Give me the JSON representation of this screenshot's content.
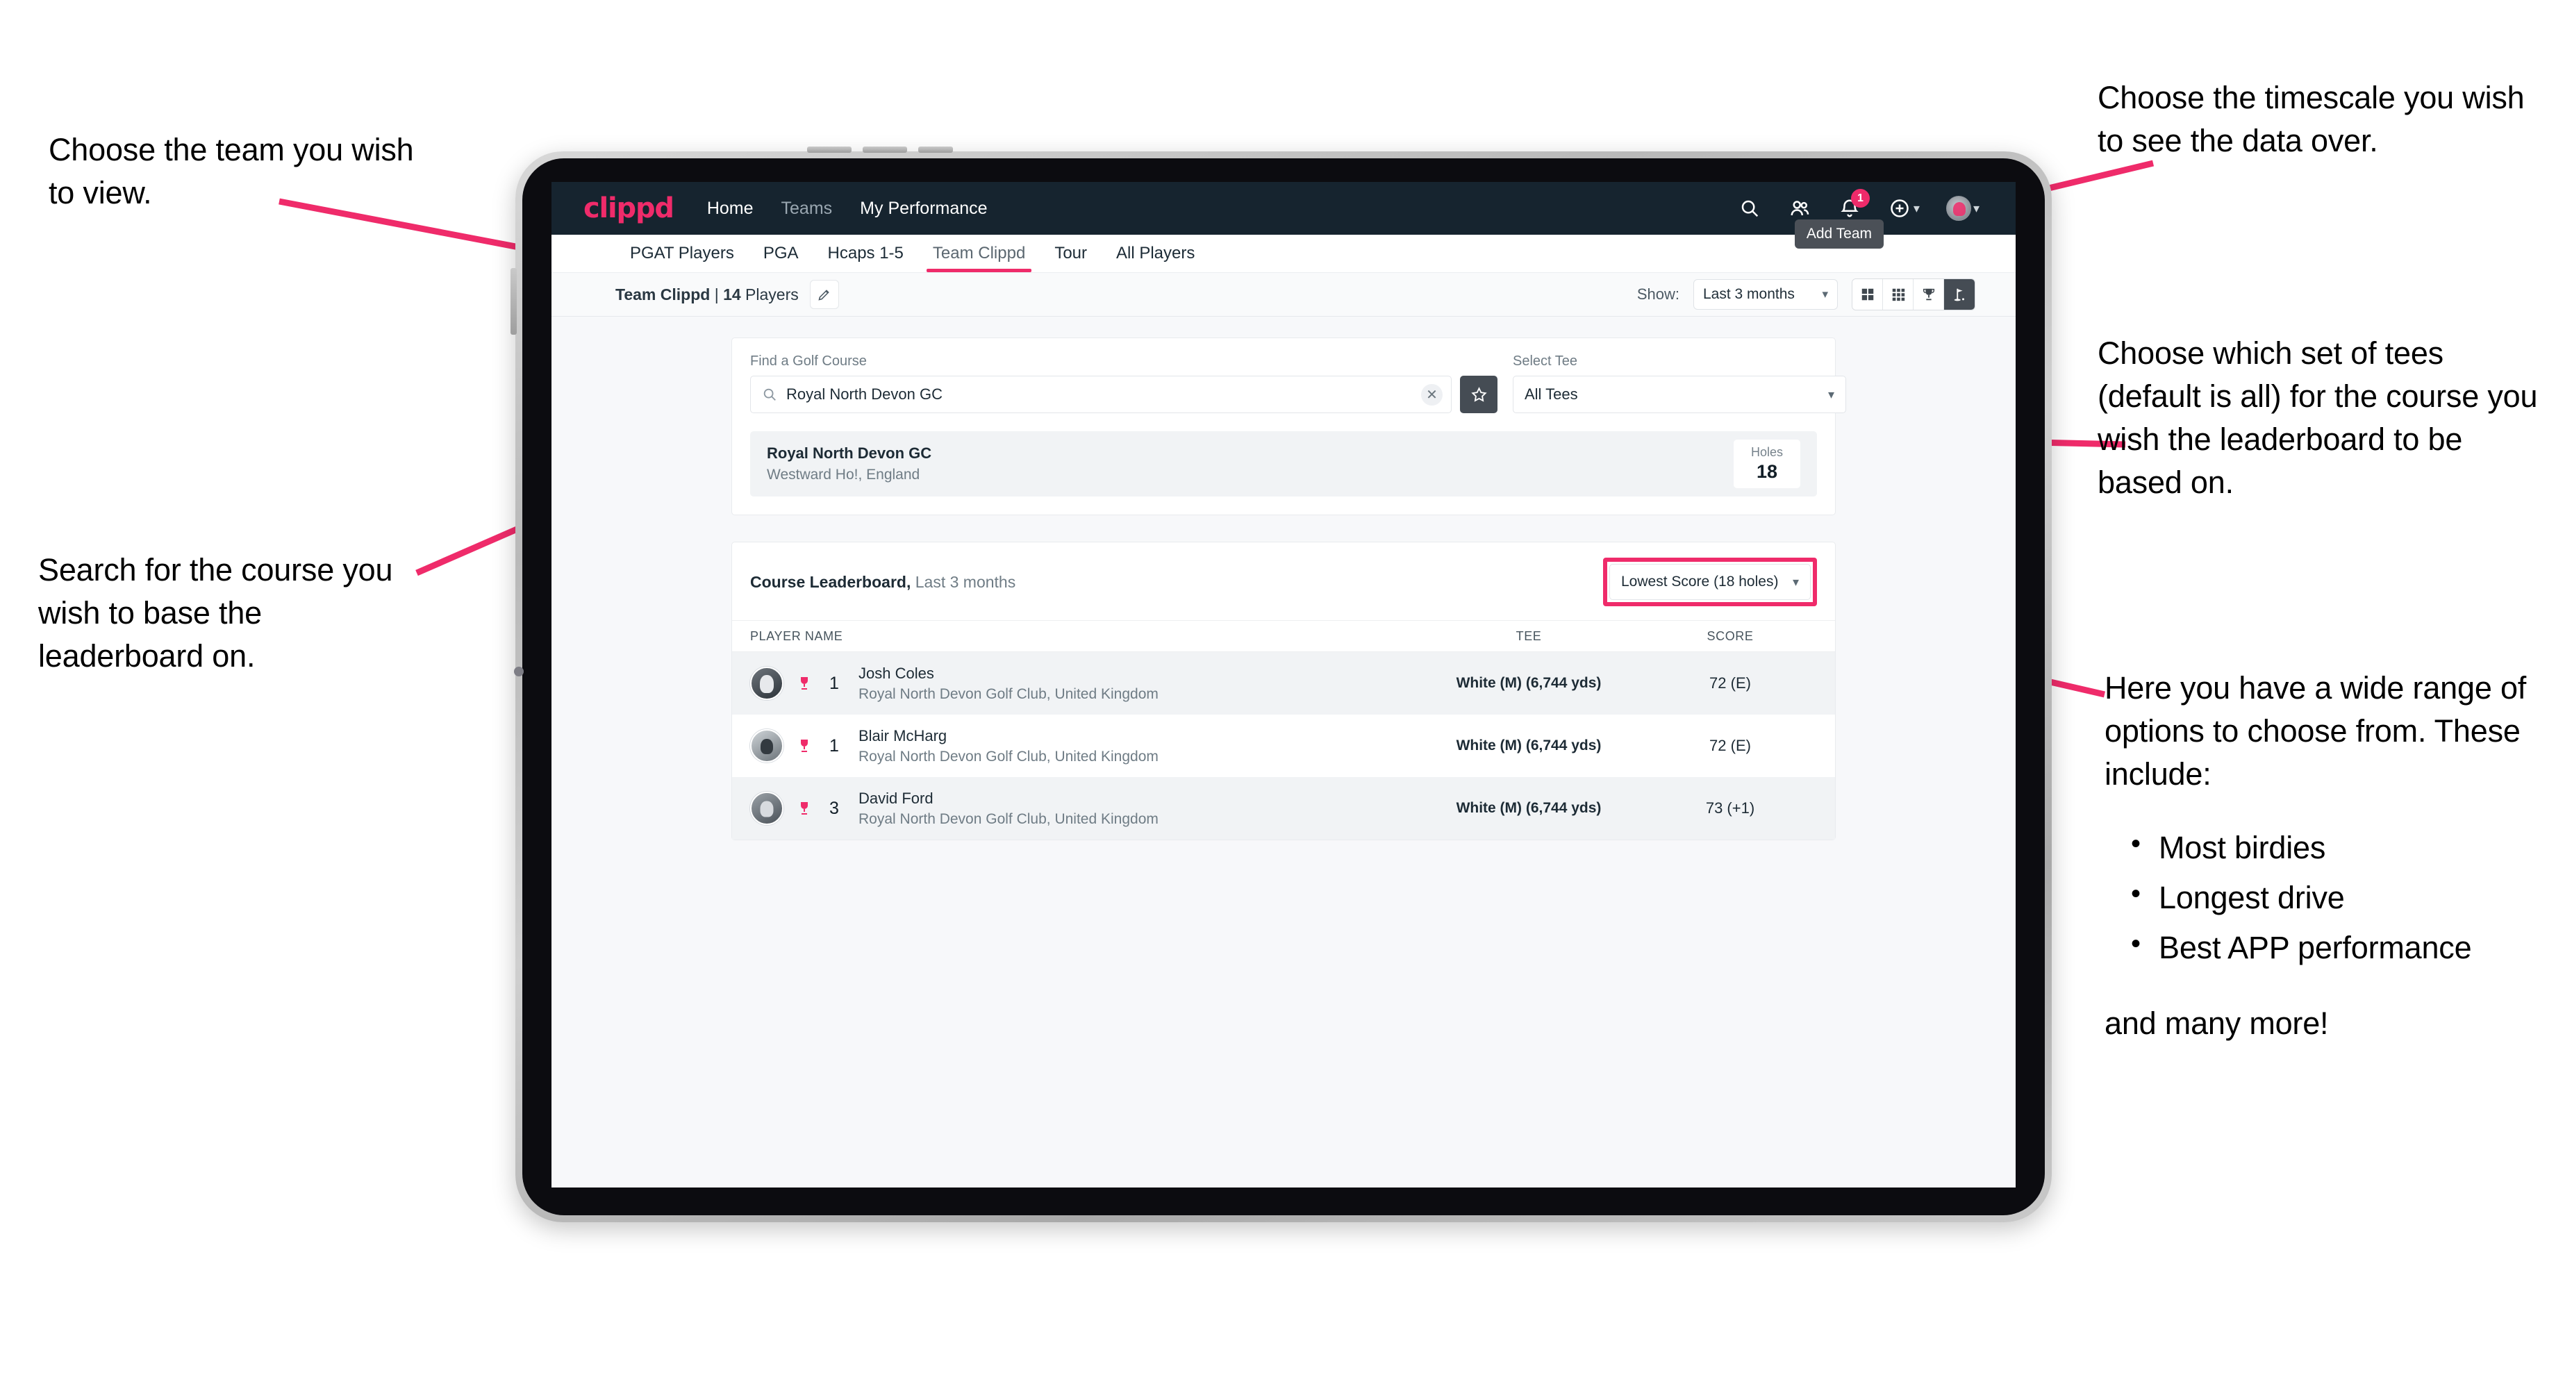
{
  "annotations": {
    "team": "Choose the team you wish to view.",
    "timescale": "Choose the timescale you wish to see the data over.",
    "tees": "Choose which set of tees (default is all) for the course you wish the leaderboard to be based on.",
    "search": "Search for the course you wish to base the leaderboard on.",
    "options_intro": "Here you have a wide range of options to choose from. These include:",
    "options_bullets": [
      "Most birdies",
      "Longest drive",
      "Best APP performance"
    ],
    "options_tail": "and many more!"
  },
  "colors": {
    "accent_pink": "#ef2b6a",
    "header_dark": "#16242f",
    "toggle_active": "#454c54"
  },
  "app": {
    "brand": "clippd",
    "nav": [
      {
        "label": "Home",
        "active": true
      },
      {
        "label": "Teams",
        "active": false
      },
      {
        "label": "My Performance",
        "active": true
      }
    ],
    "header_icons": {
      "search": "search-icon",
      "people": "people-icon",
      "notifications": "bell-icon",
      "notification_count": "1",
      "add": "plus-circle-icon",
      "profile": "avatar-icon"
    }
  },
  "tabs": {
    "items": [
      {
        "label": "PGAT Players",
        "state": "normal"
      },
      {
        "label": "PGA",
        "state": "normal"
      },
      {
        "label": "Hcaps 1-5",
        "state": "normal"
      },
      {
        "label": "Team Clippd",
        "state": "active"
      },
      {
        "label": "Tour",
        "state": "normal"
      },
      {
        "label": "All Players",
        "state": "normal"
      }
    ],
    "tooltip": "Add Team"
  },
  "subbar": {
    "team_name": "Team Clippd",
    "separator": " | ",
    "player_count": "14",
    "players_word": " Players",
    "edit_icon": "pencil-icon",
    "show_label": "Show:",
    "range_value": "Last 3 months",
    "view_toggles": [
      {
        "name": "grid-2x2-icon",
        "active": false
      },
      {
        "name": "grid-3x3-icon",
        "active": false
      },
      {
        "name": "trophy-icon",
        "active": false
      },
      {
        "name": "golf-flag-icon",
        "active": true
      }
    ]
  },
  "search_panel": {
    "course_label": "Find a Golf Course",
    "course_value": "Royal North Devon GC",
    "course_placeholder": "Find a Golf Course",
    "clear_icon": "close-icon",
    "favorite_icon": "star-icon",
    "tee_label": "Select Tee",
    "tee_value": "All Tees"
  },
  "course_result": {
    "name": "Royal North Devon GC",
    "location": "Westward Ho!, England",
    "holes_label": "Holes",
    "holes_value": "18"
  },
  "leaderboard": {
    "title": "Course Leaderboard,",
    "subtitle": " Last 3 months",
    "metric": "Lowest Score (18 holes)",
    "columns": [
      "PLAYER NAME",
      "TEE",
      "SCORE"
    ],
    "rows": [
      {
        "rank": "1",
        "name": "Josh Coles",
        "club": "Royal North Devon Golf Club, United Kingdom",
        "tee": "White (M) (6,744 yds)",
        "score": "72 (E)"
      },
      {
        "rank": "1",
        "name": "Blair McHarg",
        "club": "Royal North Devon Golf Club, United Kingdom",
        "tee": "White (M) (6,744 yds)",
        "score": "72 (E)"
      },
      {
        "rank": "3",
        "name": "David Ford",
        "club": "Royal North Devon Golf Club, United Kingdom",
        "tee": "White (M) (6,744 yds)",
        "score": "73 (+1)"
      }
    ]
  }
}
